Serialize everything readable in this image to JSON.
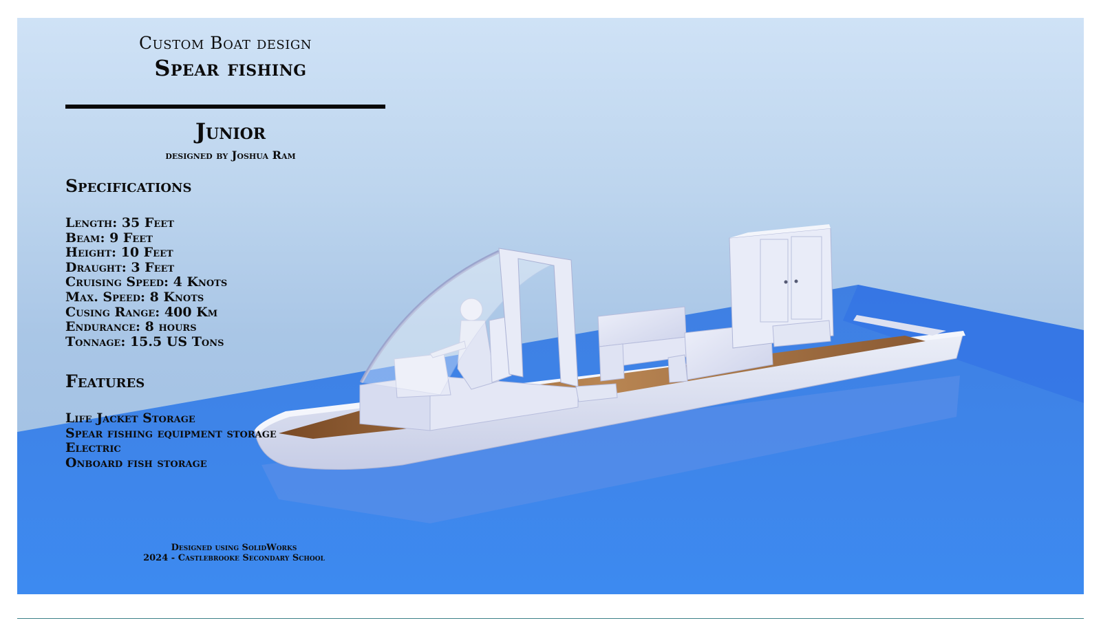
{
  "header": {
    "line1": "Custom Boat design",
    "line2": "Spear fishing"
  },
  "boat": {
    "name": "Junior",
    "designer": "designed by Joshua Ram"
  },
  "specifications": {
    "heading": "Specifications",
    "items": [
      "Length: 35 Feet",
      "Beam: 9 Feet",
      "Height:  10 Feet",
      "Draught: 3 Feet",
      "Cruising Speed: 4 Knots",
      "Max. Speed:  8 Knots",
      "Cusing Range: 400 Km",
      "Endurance: 8 hours",
      "Tonnage:  15.5 US Tons"
    ]
  },
  "features": {
    "heading": "Features",
    "items": [
      "Life Jacket Storage",
      "Spear fishing equipment storage",
      "Electric",
      "Onboard fish storage"
    ]
  },
  "footer": {
    "line1": "Designed using SolidWorks",
    "line2": "2024 - Castlebrooke Secondary School"
  },
  "colors": {
    "sky_top": "#cfe2f6",
    "water": "#3a84ea",
    "hull": "#dfe3f3",
    "deck": "#9b6a3e",
    "text": "#0c0c0c"
  }
}
